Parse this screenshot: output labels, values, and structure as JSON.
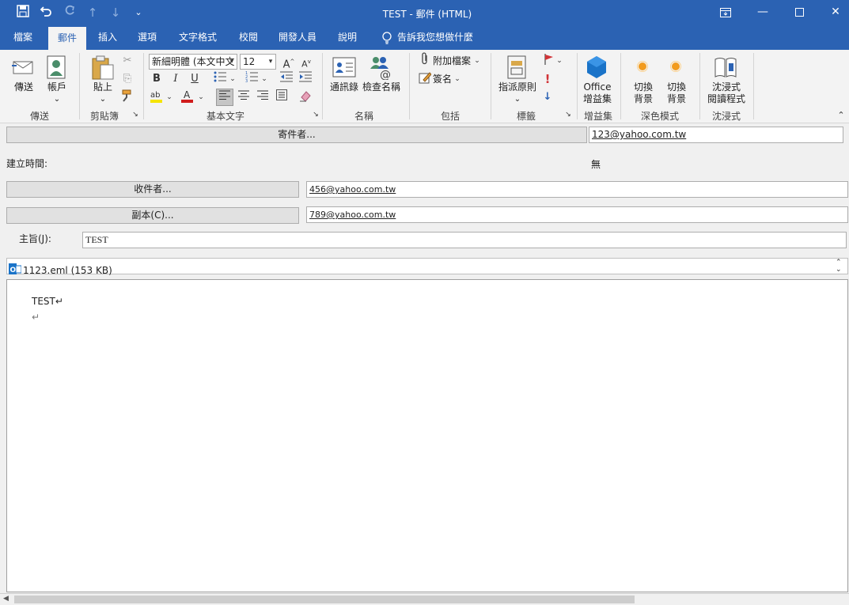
{
  "window": {
    "title": "TEST  -  郵件 (HTML)",
    "accent": "#2b62b3"
  },
  "quick_access": {
    "save_icon": "save-icon",
    "undo_icon": "undo-icon",
    "redo_icon": "redo-icon",
    "up_icon": "up-arrow-icon",
    "down_icon": "down-arrow-icon",
    "customize_icon": "customize-icon"
  },
  "tabs": [
    {
      "label": "檔案"
    },
    {
      "label": "郵件",
      "active": true
    },
    {
      "label": "插入"
    },
    {
      "label": "選項"
    },
    {
      "label": "文字格式"
    },
    {
      "label": "校閱"
    },
    {
      "label": "開發人員"
    },
    {
      "label": "說明"
    }
  ],
  "tell_me": "告訴我您想做什麼",
  "ribbon": {
    "send": {
      "label": "傳送",
      "account_label": "帳戶",
      "group": "傳送"
    },
    "clipboard": {
      "paste_label": "貼上",
      "group": "剪貼簿"
    },
    "basic_text": {
      "font": "新細明體 (本文中文",
      "size": "12",
      "bold": "B",
      "italic": "I",
      "underline": "U",
      "group": "基本文字"
    },
    "names": {
      "address_book": "通訊錄",
      "check_names": "檢查名稱",
      "group": "名稱"
    },
    "include": {
      "attach_file": "附加檔案",
      "signature": "簽名",
      "group": "包括"
    },
    "tags": {
      "assign_policy": "指派原則",
      "group": "標籤"
    },
    "addins": {
      "office_line1": "Office",
      "office_line2": "增益集",
      "group": "增益集"
    },
    "dark_mode": {
      "switch1_line1": "切換",
      "switch1_line2": "背景",
      "switch2_line1": "切換",
      "switch2_line2": "背景",
      "group": "深色模式"
    },
    "immersive": {
      "reader_line1": "沈浸式",
      "reader_line2": "閱讀程式",
      "group": "沈浸式"
    }
  },
  "header": {
    "from_button": "寄件者...",
    "from_value": "123@yahoo.com.tw",
    "created_label": "建立時間:",
    "created_value": "無",
    "to_button": "收件者...",
    "to_value": "456@yahoo.com.tw",
    "cc_button": "副本(C)...",
    "cc_value": "789@yahoo.com.tw",
    "subject_label": "主旨(J):",
    "subject_value": "TEST"
  },
  "attachment": {
    "name": "1123.eml (153 KB)"
  },
  "body": {
    "line1": "TEST↵",
    "line2": "↵"
  }
}
